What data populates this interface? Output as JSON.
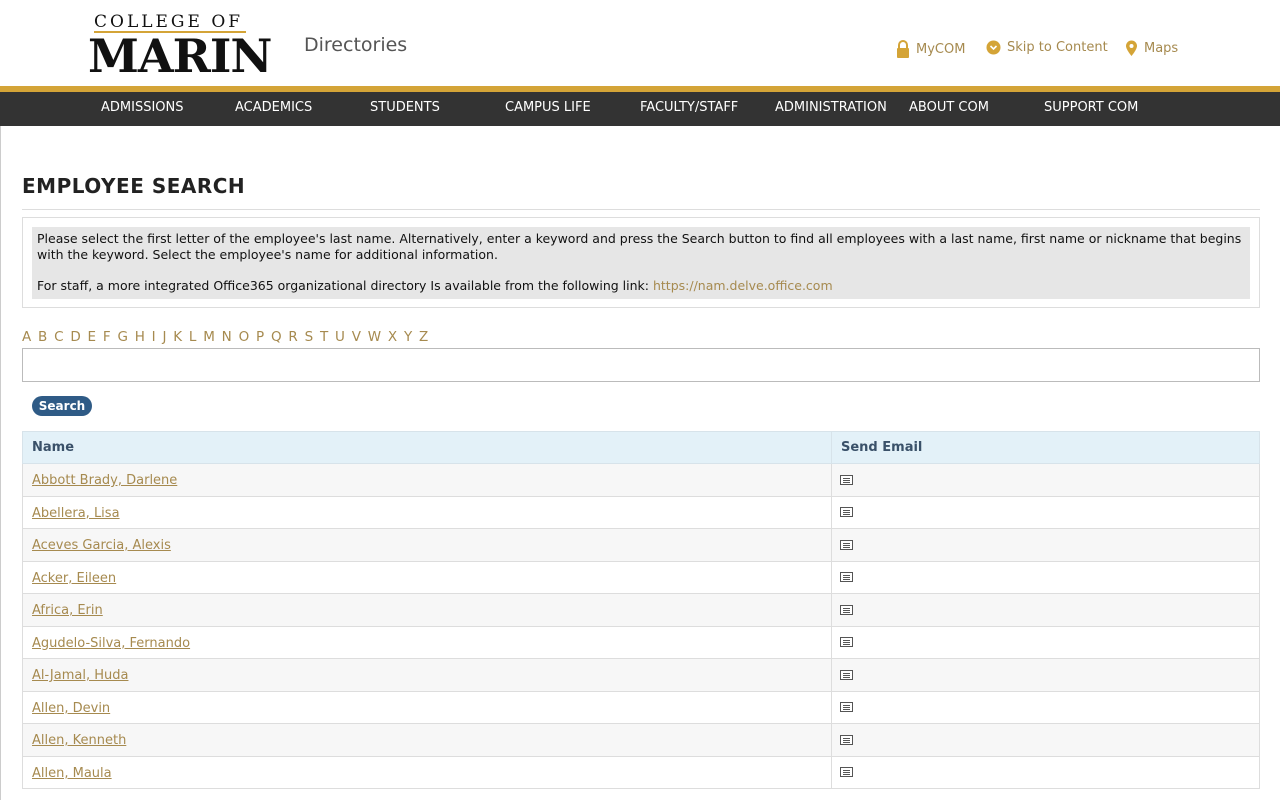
{
  "header": {
    "logo_top": "COLLEGE OF",
    "logo_main": "MARIN",
    "site_title": "Directories",
    "utility": [
      {
        "label": "MyCOM",
        "icon": "lock-icon"
      },
      {
        "label": "Skip to Content",
        "icon": "chevron-down-circle-icon"
      },
      {
        "label": "Maps",
        "icon": "map-pin-icon"
      }
    ]
  },
  "nav": {
    "items": [
      "ADMISSIONS",
      "ACADEMICS",
      "STUDENTS",
      "CAMPUS LIFE",
      "FACULTY/STAFF",
      "ADMINISTRATION",
      "ABOUT COM",
      "SUPPORT COM"
    ]
  },
  "main": {
    "heading": "EMPLOYEE SEARCH",
    "info_line1": "Please select the first letter of the employee's last name.  Alternatively, enter a keyword and press the Search button to find all employees with a last name, first name or nickname that begins with the keyword.  Select the employee's name for additional information.",
    "info_line2_prefix": "For staff, a more integrated Office365 organizational directory Is available from the following link: ",
    "info_link": "https://nam.delve.office.com",
    "alphabet": [
      "A",
      "B",
      "C",
      "D",
      "E",
      "F",
      "G",
      "H",
      "I",
      "J",
      "K",
      "L",
      "M",
      "N",
      "O",
      "P",
      "Q",
      "R",
      "S",
      "T",
      "U",
      "V",
      "W",
      "X",
      "Y",
      "Z"
    ],
    "search_value": "",
    "search_button": "Search",
    "table": {
      "headers": [
        "Name",
        "Send Email"
      ],
      "rows": [
        "Abbott Brady, Darlene",
        "Abellera, Lisa",
        "Aceves Garcia, Alexis",
        "Acker, Eileen",
        "Africa, Erin",
        "Agudelo-Silva, Fernando",
        "Al-Jamal, Huda",
        "Allen, Devin",
        "Allen, Kenneth",
        "Allen, Maula"
      ]
    }
  },
  "colors": {
    "accent_gold": "#d4a437",
    "link_gold": "#a68a4f",
    "nav_bg": "#333333",
    "button_blue": "#2f5b86",
    "table_header_bg": "#e3f1f8"
  }
}
